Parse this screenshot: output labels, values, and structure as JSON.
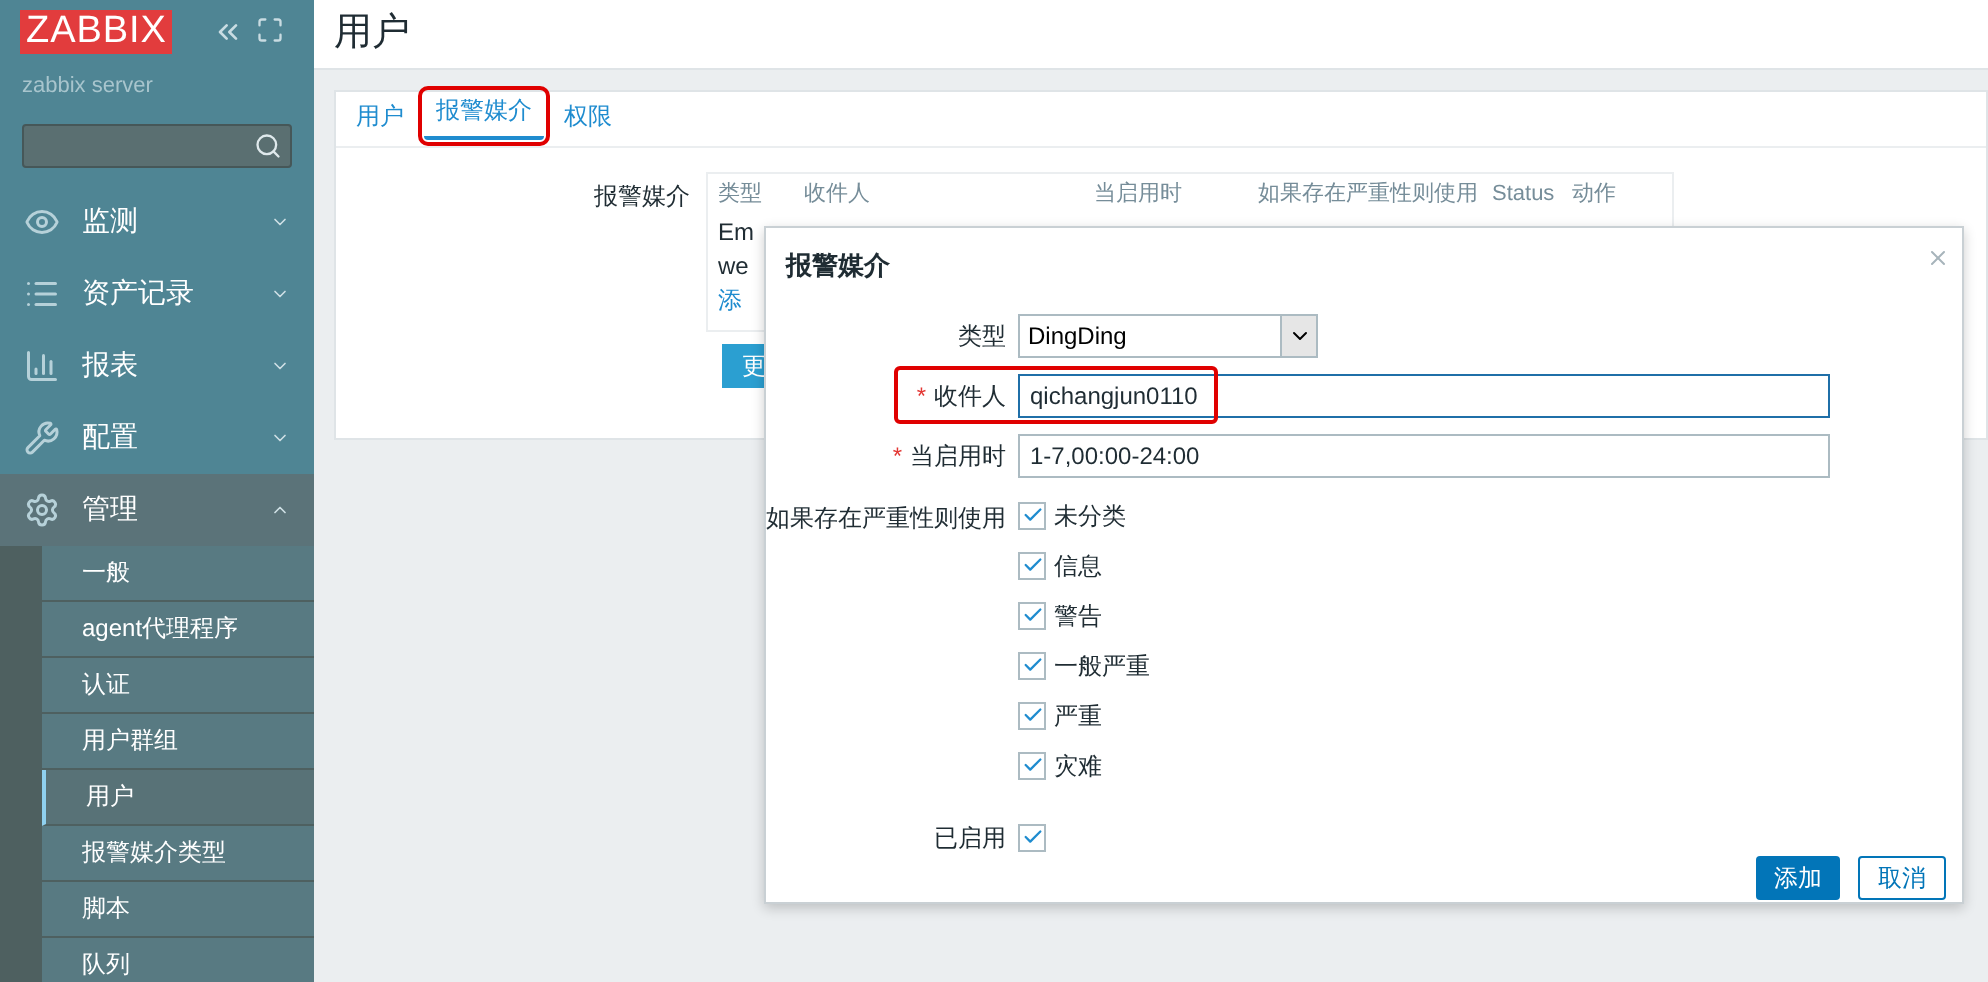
{
  "sidebar": {
    "logo": "ZABBIX",
    "server": "zabbix server",
    "menu": [
      {
        "label": "监测",
        "expanded": false
      },
      {
        "label": "资产记录",
        "expanded": false
      },
      {
        "label": "报表",
        "expanded": false
      },
      {
        "label": "配置",
        "expanded": false
      },
      {
        "label": "管理",
        "expanded": true,
        "children": [
          {
            "label": "一般",
            "selected": false
          },
          {
            "label": "agent代理程序",
            "selected": false
          },
          {
            "label": "认证",
            "selected": false
          },
          {
            "label": "用户群组",
            "selected": false
          },
          {
            "label": "用户",
            "selected": true
          },
          {
            "label": "报警媒介类型",
            "selected": false
          },
          {
            "label": "脚本",
            "selected": false
          },
          {
            "label": "队列",
            "selected": false
          }
        ]
      }
    ]
  },
  "page_title": "用户",
  "tabs": [
    {
      "label": "用户",
      "selected": false,
      "highlighted": false
    },
    {
      "label": "报警媒介",
      "selected": true,
      "highlighted": true
    },
    {
      "label": "权限",
      "selected": false,
      "highlighted": false
    }
  ],
  "media": {
    "label": "报警媒介",
    "columns": [
      "类型",
      "收件人",
      "当启用时",
      "如果存在严重性则使用",
      "Status",
      "动作"
    ],
    "rows": [
      "Em",
      "we"
    ],
    "add_link": "添",
    "update_button": "更"
  },
  "dialog": {
    "title": "报警媒介",
    "type": {
      "label": "类型",
      "value": "DingDing"
    },
    "sendto": {
      "label": "收件人",
      "required_mark": "*",
      "value": "qichangjun0110",
      "highlighted": true
    },
    "period": {
      "label": "当启用时",
      "required_mark": "*",
      "value": "1-7,00:00-24:00"
    },
    "severity_label": "如果存在严重性则使用",
    "severities": [
      {
        "label": "未分类",
        "checked": true
      },
      {
        "label": "信息",
        "checked": true
      },
      {
        "label": "警告",
        "checked": true
      },
      {
        "label": "一般严重",
        "checked": true
      },
      {
        "label": "严重",
        "checked": true
      },
      {
        "label": "灾难",
        "checked": true
      }
    ],
    "enabled": {
      "label": "已启用",
      "checked": true
    },
    "buttons": [
      {
        "label": "添加",
        "kind": "primary"
      },
      {
        "label": "取消",
        "kind": "secondary"
      }
    ]
  }
}
